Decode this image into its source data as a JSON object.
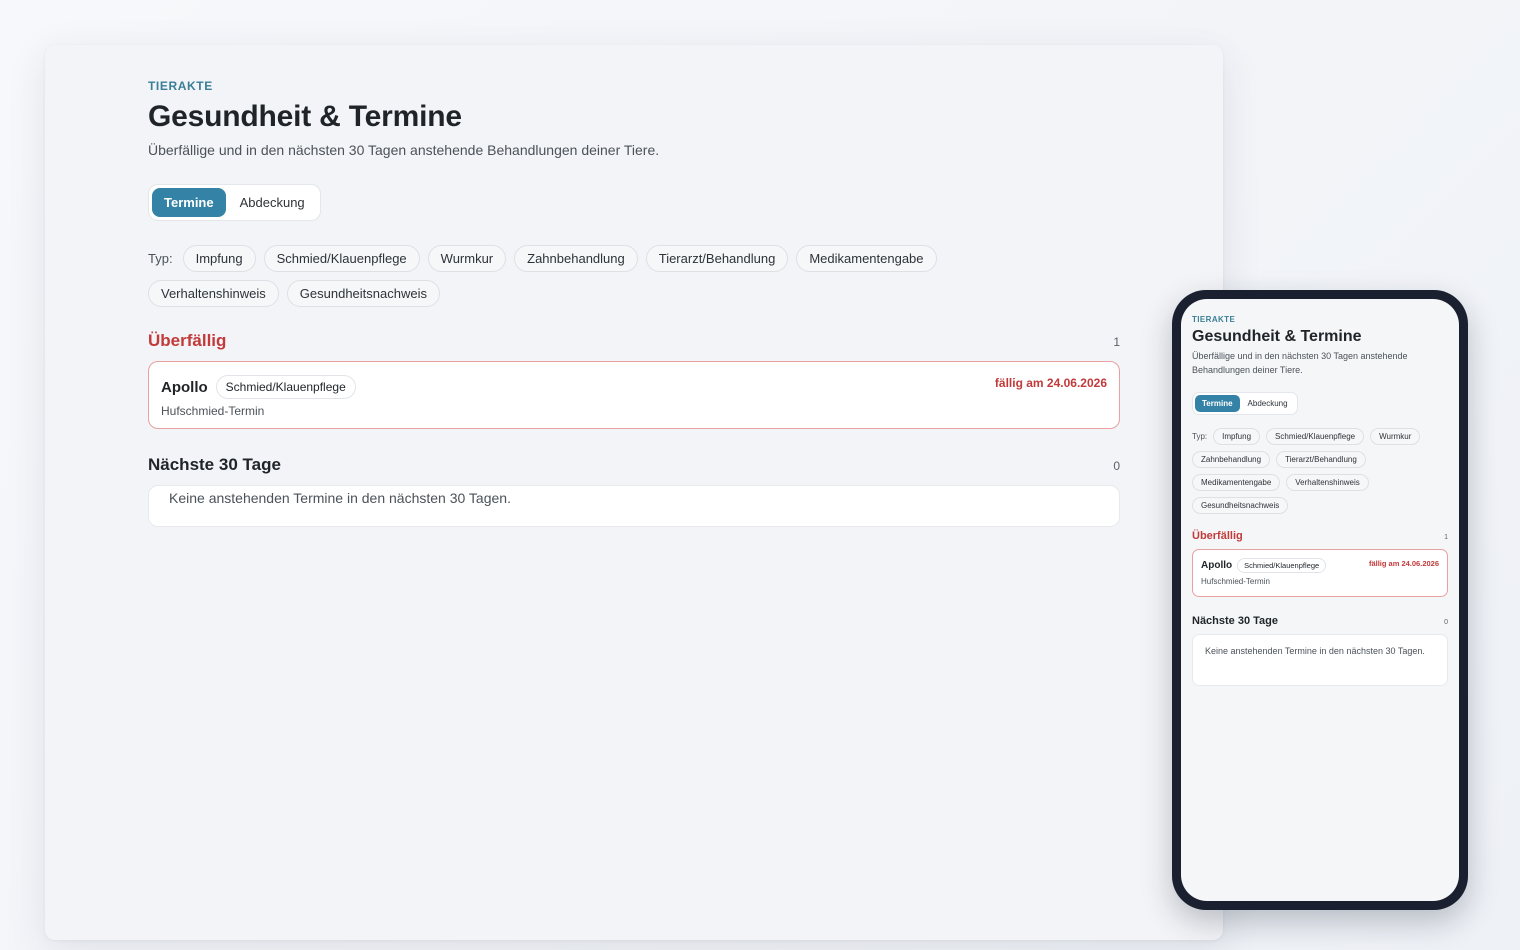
{
  "page": {
    "eyebrow": "TIERAKTE",
    "title": "Gesundheit & Termine",
    "subtitle": "Überfällige und in den nächsten 30 Tagen anstehende Behandlungen deiner Tiere."
  },
  "tabs": [
    {
      "label": "Termine",
      "active": true
    },
    {
      "label": "Abdeckung",
      "active": false
    }
  ],
  "filters": {
    "label": "Typ:",
    "chips": [
      "Impfung",
      "Schmied/Klauenpflege",
      "Wurmkur",
      "Zahnbehandlung",
      "Tierarzt/Behandlung",
      "Medikamentengabe",
      "Verhaltenshinweis",
      "Gesundheitsnachweis"
    ]
  },
  "overdue": {
    "title": "Überfällig",
    "count": "1",
    "items": [
      {
        "pet": "Apollo",
        "type": "Schmied/Klauenpflege",
        "note": "Hufschmied-Termin",
        "due": "fällig am 24.06.2026"
      }
    ]
  },
  "upcoming": {
    "title": "Nächste 30 Tage",
    "count": "0",
    "empty_text": "Keine anstehenden Termine in den nächsten 30 Tagen."
  },
  "colors": {
    "accent": "#3483a6",
    "eyebrow": "#3a7f96",
    "danger": "#c23a3a",
    "danger_border": "#e7a1a1",
    "phone_frame": "#1b2030"
  }
}
